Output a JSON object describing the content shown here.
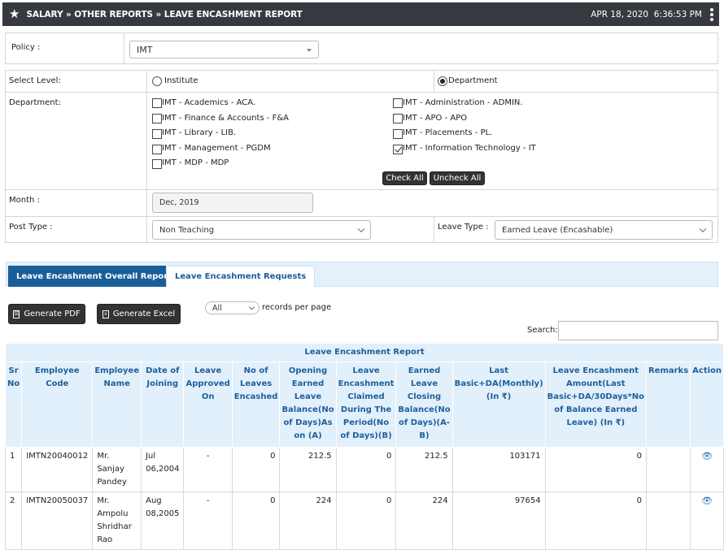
{
  "header": {
    "breadcrumb": "SALARY » OTHER REPORTS » LEAVE ENCASHMENT REPORT",
    "date": "APR 18, 2020",
    "time": "6:36:53 PM"
  },
  "policy": {
    "label": "Policy :",
    "value": "IMT"
  },
  "level": {
    "label": "Select Level:",
    "options": [
      "Institute",
      "Department"
    ],
    "selected": "Department"
  },
  "department": {
    "label": "Department:",
    "left": [
      {
        "text": "IMT - Academics - ACA.",
        "checked": false
      },
      {
        "text": "IMT - Finance & Accounts - F&A",
        "checked": false
      },
      {
        "text": "IMT - Library - LIB.",
        "checked": false
      },
      {
        "text": "IMT - Management - PGDM",
        "checked": false
      },
      {
        "text": "IMT - MDP - MDP",
        "checked": false
      }
    ],
    "right": [
      {
        "text": "IMT - Administration - ADMIN.",
        "checked": false
      },
      {
        "text": "IMT - APO - APO",
        "checked": false
      },
      {
        "text": "IMT - Placements - PL.",
        "checked": false
      },
      {
        "text": "IMT - Information Technology - IT",
        "checked": true
      }
    ],
    "check_all": "Check All",
    "uncheck_all": "Uncheck All"
  },
  "month": {
    "label": "Month :",
    "value": "Dec, 2019"
  },
  "post_type": {
    "label": "Post Type :",
    "value": "Non Teaching"
  },
  "leave_type": {
    "label": "Leave Type :",
    "value": "Earned Leave (Encashable)"
  },
  "tabs": [
    "Leave Encashment Overall Report",
    "Leave Encashment Requests"
  ],
  "toolbar": {
    "pdf": "Generate PDF",
    "excel": "Generate Excel",
    "records_value": "All",
    "records_label": "records per page",
    "search_label": "Search:"
  },
  "table": {
    "caption": "Leave Encashment Report",
    "headers": [
      "Sr No",
      "Employee Code",
      "Employee Name",
      "Date of Joining",
      "Leave Approved On",
      "No of Leaves Encashed",
      "Opening Earned Leave Balance(No of Days)As on (A)",
      "Leave Encashment Claimed During The Period(No of Days)(B)",
      "Earned Leave Closing Balance(No of Days)(A-B)",
      "Last Basic+DA(Monthly) (In ₹)",
      "Leave Encashment Amount(Last Basic+DA/30Days*No of Balance Earned Leave) (In ₹)",
      "Remarks",
      "Action"
    ],
    "rows": [
      {
        "sr": "1",
        "code": "IMTN20040012",
        "name": "Mr. Sanjay Pandey",
        "doj": "Jul 06,2004",
        "approved": "-",
        "encashed": "0",
        "opening": "212.5",
        "claimed": "0",
        "closing": "212.5",
        "basic": "103171",
        "amount": "0",
        "remarks": ""
      },
      {
        "sr": "2",
        "code": "IMTN20050037",
        "name": "Mr. Ampolu Shridhar Rao",
        "doj": "Aug 08,2005",
        "approved": "-",
        "encashed": "0",
        "opening": "224",
        "claimed": "0",
        "closing": "224",
        "basic": "97654",
        "amount": "0",
        "remarks": ""
      }
    ]
  }
}
